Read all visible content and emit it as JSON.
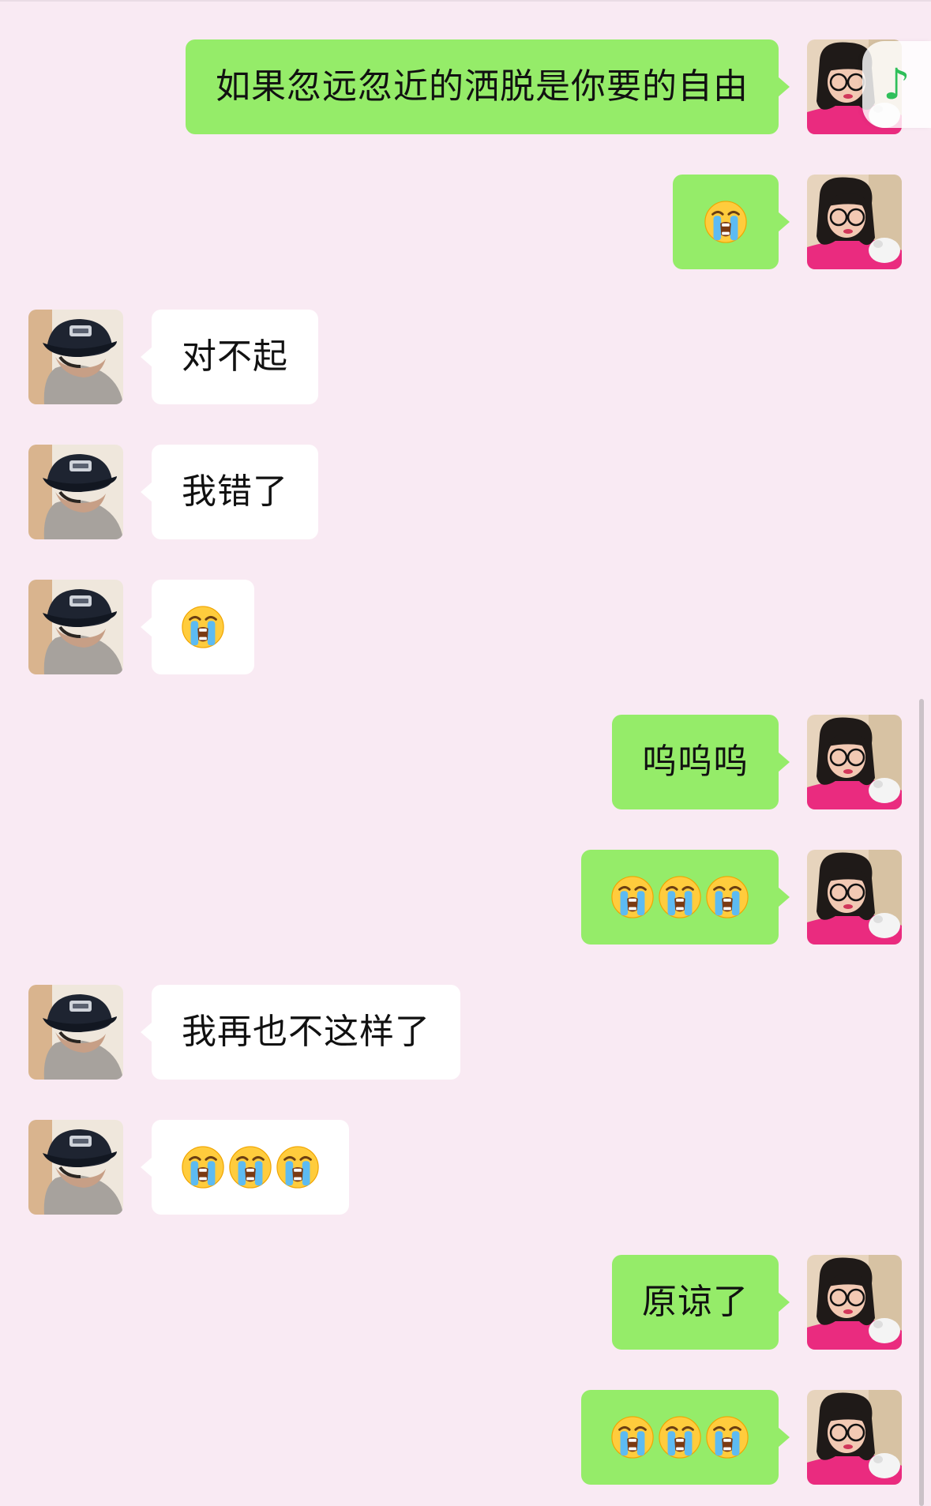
{
  "colors": {
    "background": "#f9eaf3",
    "self_bubble": "#95ec69",
    "other_bubble": "#ffffff",
    "text": "#111111",
    "music_icon": "#2fbf5a",
    "scrollbar": "#cbc2c8"
  },
  "music_widget": {
    "icon": "music-note-icon",
    "glyph": "♪"
  },
  "messages": [
    {
      "sender": "self",
      "type": "text",
      "text": "如果忽远忽近的洒脱是你要的自由"
    },
    {
      "sender": "self",
      "type": "emoji",
      "emoji": "loudly-crying-face",
      "count": 1
    },
    {
      "sender": "other",
      "type": "text",
      "text": "对不起"
    },
    {
      "sender": "other",
      "type": "text",
      "text": "我错了"
    },
    {
      "sender": "other",
      "type": "emoji",
      "emoji": "loudly-crying-face",
      "count": 1
    },
    {
      "sender": "self",
      "type": "text",
      "text": "呜呜呜"
    },
    {
      "sender": "self",
      "type": "emoji",
      "emoji": "loudly-crying-face",
      "count": 3
    },
    {
      "sender": "other",
      "type": "text",
      "text": "我再也不这样了"
    },
    {
      "sender": "other",
      "type": "emoji",
      "emoji": "loudly-crying-face",
      "count": 3
    },
    {
      "sender": "self",
      "type": "text",
      "text": "原谅了"
    },
    {
      "sender": "self",
      "type": "emoji",
      "emoji": "loudly-crying-face",
      "count": 3
    }
  ]
}
